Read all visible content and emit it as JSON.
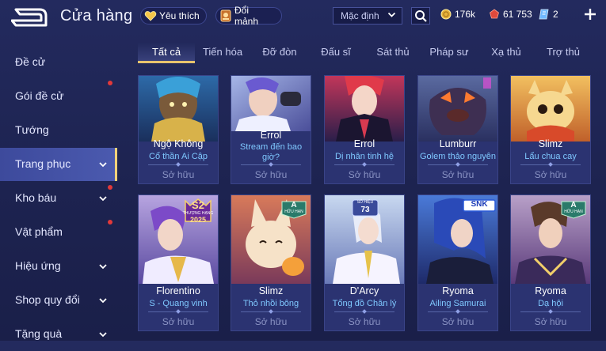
{
  "header": {
    "title": "Cửa hàng",
    "favorites_label": "Yêu thích",
    "exchange_label": "Đổi mảnh",
    "sort_value": "Mặc định",
    "currencies": [
      {
        "icon": "gold-coin-icon",
        "value": "176k"
      },
      {
        "icon": "ruby-gem-icon",
        "value": "61 753"
      },
      {
        "icon": "voucher-icon",
        "value": "2"
      }
    ]
  },
  "sidebar": {
    "items": [
      {
        "label": "Đề cử",
        "has_chevron": false,
        "notification": false,
        "active": false
      },
      {
        "label": "Gói đề cử",
        "has_chevron": false,
        "notification": true,
        "active": false
      },
      {
        "label": "Tướng",
        "has_chevron": false,
        "notification": false,
        "active": false
      },
      {
        "label": "Trang phục",
        "has_chevron": true,
        "notification": false,
        "active": true
      },
      {
        "label": "Kho báu",
        "has_chevron": true,
        "notification": true,
        "active": false
      },
      {
        "label": "Vật phẩm",
        "has_chevron": false,
        "notification": true,
        "active": false
      },
      {
        "label": "Hiệu ứng",
        "has_chevron": true,
        "notification": false,
        "active": false
      },
      {
        "label": "Shop quy đổi",
        "has_chevron": true,
        "notification": false,
        "active": false
      },
      {
        "label": "Tặng quà",
        "has_chevron": true,
        "notification": false,
        "active": false
      }
    ]
  },
  "tabs": [
    "Tất cả",
    "Tiến hóa",
    "Đỡ đòn",
    "Đấu sĩ",
    "Sát thủ",
    "Pháp sư",
    "Xạ thủ",
    "Trợ thủ"
  ],
  "active_tab": "Tất cả",
  "cards_row1": [
    {
      "hero": "Ngộ Không",
      "skin": "Cổ thần Ai Cập",
      "status": "Sở hữu"
    },
    {
      "hero": "Errol",
      "skin": "Stream đến bao giờ?",
      "status": "Sở hữu"
    },
    {
      "hero": "Errol",
      "skin": "Dị nhân tinh hệ",
      "status": "Sở hữu"
    },
    {
      "hero": "Lumburr",
      "skin": "Golem thảo nguyên",
      "status": "Sở hữu"
    },
    {
      "hero": "Slimz",
      "skin": "Lẩu chua cay",
      "status": "Sở hữu"
    }
  ],
  "cards_row2": [
    {
      "hero": "Florentino",
      "skin": "S - Quang vinh",
      "status": "Sở hữu",
      "badge_text": "S2",
      "badge_sub": "THƯỢNG HẠNG",
      "badge_year": "2025"
    },
    {
      "hero": "Slimz",
      "skin": "Thỏ nhồi bông",
      "status": "Sở hữu",
      "badge_text": "A",
      "badge_sub": "HỮU HẠN"
    },
    {
      "hero": "D'Arcy",
      "skin": "Tổng đồ Chân lý",
      "status": "Sở hữu",
      "badge_text": "73",
      "badge_sub": "SỐ HIỆU"
    },
    {
      "hero": "Ryoma",
      "skin": "Ailing Samurai",
      "status": "Sở hữu",
      "badge_text": "SNK"
    },
    {
      "hero": "Ryoma",
      "skin": "Dạ hội",
      "status": "Sở hữu",
      "badge_text": "A",
      "badge_sub": "HỮU HẠN"
    }
  ],
  "colors": {
    "accent_gold": "#e7c36d",
    "skin_name_blue": "#7fc8ff",
    "notification_red": "#e2393a",
    "background": "#1f2553"
  }
}
